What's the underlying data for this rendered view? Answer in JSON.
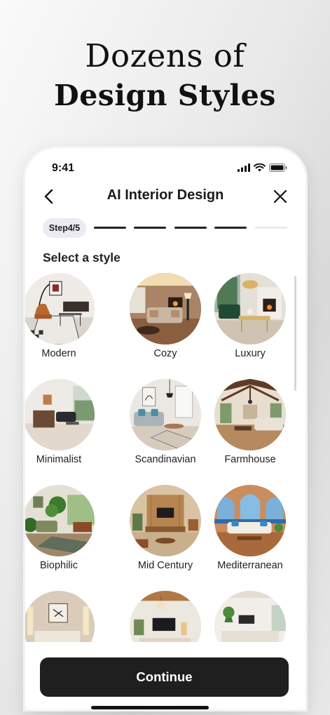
{
  "headline": {
    "line1": "Dozens of",
    "line2": "Design Styles"
  },
  "status_bar": {
    "time": "9:41"
  },
  "nav": {
    "title": "AI Interior Design",
    "back_icon": "chevron-left-icon",
    "close_icon": "close-icon"
  },
  "progress": {
    "step_label": "Step4/5",
    "current_step": 4,
    "total_steps": 5,
    "active_color": "#222222",
    "inactive_color": "#ebebeb"
  },
  "section_title": "Select a style",
  "styles": [
    {
      "label": "Modern"
    },
    {
      "label": "Cozy"
    },
    {
      "label": "Luxury"
    },
    {
      "label": "Minimalist"
    },
    {
      "label": "Scandinavian"
    },
    {
      "label": "Farmhouse"
    },
    {
      "label": "Biophilic"
    },
    {
      "label": "Mid Century"
    },
    {
      "label": "Mediterranean"
    },
    {
      "label": ""
    },
    {
      "label": ""
    },
    {
      "label": ""
    }
  ],
  "continue_button": {
    "label": "Continue"
  }
}
